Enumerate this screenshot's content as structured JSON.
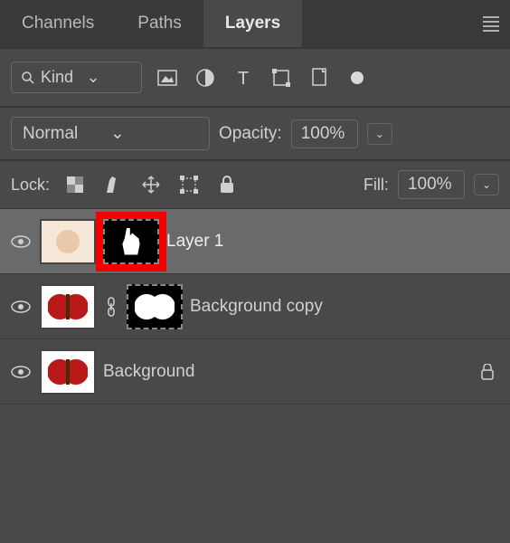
{
  "tabs": {
    "channels": "Channels",
    "paths": "Paths",
    "layers": "Layers",
    "active": "layers"
  },
  "filter": {
    "kind_label": "Kind"
  },
  "blend": {
    "mode": "Normal",
    "opacity_label": "Opacity:",
    "opacity_value": "100%"
  },
  "lock": {
    "label": "Lock:",
    "fill_label": "Fill:",
    "fill_value": "100%"
  },
  "layers": [
    {
      "name": "Layer 1",
      "visible": true,
      "selected": true,
      "has_mask": true,
      "mask_highlighted": true,
      "locked": false,
      "thumb_kind": "face",
      "mask_kind": "hand",
      "linked": false
    },
    {
      "name": "Background copy",
      "visible": true,
      "selected": false,
      "has_mask": true,
      "mask_highlighted": false,
      "locked": false,
      "thumb_kind": "butterfly",
      "mask_kind": "butterfly",
      "linked": true
    },
    {
      "name": "Background",
      "visible": true,
      "selected": false,
      "has_mask": false,
      "locked": true,
      "thumb_kind": "butterfly",
      "linked": false
    }
  ]
}
